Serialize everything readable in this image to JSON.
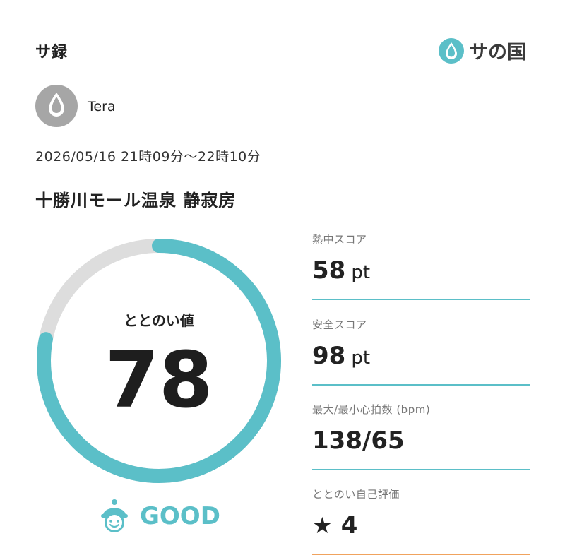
{
  "header": {
    "title": "サ録",
    "brand_name": "サの国"
  },
  "user": {
    "name": "Tera"
  },
  "session": {
    "time": "2026/05/16 21時09分〜22時10分"
  },
  "facility": {
    "name": "十勝川モール温泉 静寂房"
  },
  "totonoi": {
    "label": "ととのい値",
    "value": "78",
    "fraction": 0.78,
    "rating": "GOOD",
    "rating_icon": "smiling-sauna-hat-icon"
  },
  "metrics": [
    {
      "label": "熱中スコア",
      "value": "58",
      "unit": "pt"
    },
    {
      "label": "安全スコア",
      "value": "98",
      "unit": "pt"
    },
    {
      "label": "最大/最小心拍数 (bpm)",
      "value": "138/65",
      "unit": ""
    },
    {
      "label": "ととのい自己評価",
      "value": "4",
      "unit": "",
      "icon": "star-icon"
    }
  ],
  "colors": {
    "accent": "#5bbfc8",
    "track": "#dddddd",
    "self_rating_line": "#f0a35e",
    "avatar": "#a6a6a6"
  }
}
